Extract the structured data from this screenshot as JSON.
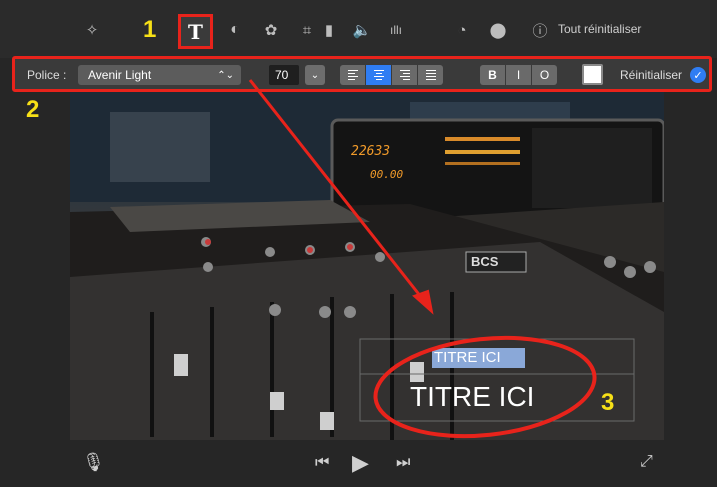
{
  "toolbar": {
    "active_tool": "T",
    "reset_all_label": "Tout réinitialiser",
    "icons": [
      "magic-wand",
      "text",
      "color-balance",
      "color-palette",
      "crop",
      "stabilization",
      "volume",
      "equalizer",
      "speed",
      "filters",
      "info"
    ]
  },
  "callouts": {
    "one": "1",
    "two": "2",
    "three": "3"
  },
  "format_bar": {
    "font_label": "Police :",
    "font_value": "Avenir Light",
    "size_value": "70",
    "bold_label": "B",
    "italic_label": "I",
    "outline_label": "O",
    "reset_label": "Réinitialiser",
    "active_alignment": "center",
    "color_swatch": "#ffffff"
  },
  "video": {
    "title_line1": "TITRE ICI",
    "title_line2": "TITRE ICI",
    "console_readout1": "22633",
    "console_readout2": "00.00",
    "console_brand": "BCS"
  },
  "colors": {
    "highlight": "#e8231b",
    "callout": "#f7e017",
    "accent": "#2f7df3"
  }
}
